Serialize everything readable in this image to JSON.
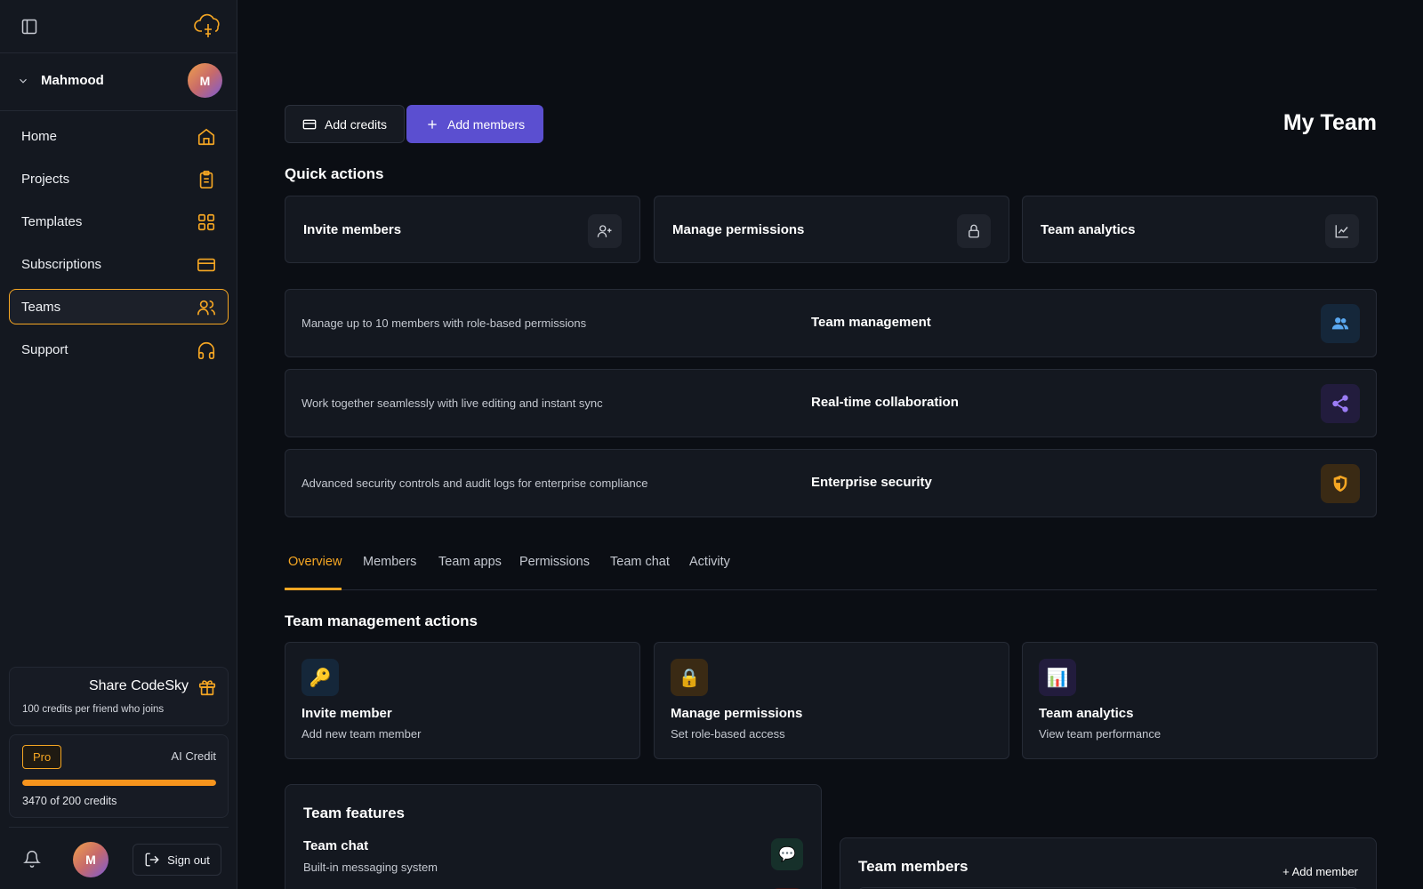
{
  "sidebar": {
    "user": {
      "name": "Mahmood",
      "initial": "M"
    },
    "nav": [
      {
        "label": "Home",
        "icon": "home-icon"
      },
      {
        "label": "Projects",
        "icon": "clipboard-icon"
      },
      {
        "label": "Templates",
        "icon": "grid-icon"
      },
      {
        "label": "Subscriptions",
        "icon": "credit-card-icon"
      },
      {
        "label": "Teams",
        "icon": "users-icon",
        "active": true
      },
      {
        "label": "Support",
        "icon": "headphones-icon"
      }
    ],
    "share": {
      "title": "Share CodeSky",
      "subtitle": "100 credits per friend who joins"
    },
    "credits": {
      "plan": "Pro",
      "label": "AI Credit",
      "text": "3470 of 200 credits",
      "progress_fraction": 1.0
    },
    "footer": {
      "avatar_initial": "M",
      "signout_label": "Sign out"
    }
  },
  "header": {
    "add_credits_label": "Add credits",
    "add_members_label": "Add members",
    "title": "My Team"
  },
  "quick_actions": {
    "title": "Quick actions",
    "items": [
      {
        "label": "Invite members",
        "icon": "user-plus-icon"
      },
      {
        "label": "Manage permissions",
        "icon": "lock-icon"
      },
      {
        "label": "Team analytics",
        "icon": "line-chart-icon"
      }
    ]
  },
  "features": [
    {
      "description": "Manage up to 10 members with role-based permissions",
      "title": "Team management",
      "icon": "users-icon",
      "icon_color": "#5aa8f0",
      "icon_bg": "#15273a"
    },
    {
      "description": "Work together seamlessly with live editing and instant sync",
      "title": "Real-time collaboration",
      "icon": "share-icon",
      "icon_color": "#9b7cf5",
      "icon_bg": "#221c3d"
    },
    {
      "description": "Advanced security controls and audit logs for enterprise compliance",
      "title": "Enterprise security",
      "icon": "shield-icon",
      "icon_color": "#f5a623",
      "icon_bg": "#3a2a14"
    }
  ],
  "tabs": [
    {
      "label": "Overview",
      "active": true
    },
    {
      "label": "Members"
    },
    {
      "label": "Team apps"
    },
    {
      "label": "Permissions"
    },
    {
      "label": "Team chat"
    },
    {
      "label": "Activity"
    }
  ],
  "management": {
    "title": "Team management actions",
    "items": [
      {
        "icon": "🔑",
        "icon_name": "key-icon",
        "icon_bg": "#15273a",
        "title": "Invite member",
        "subtitle": "Add new team member"
      },
      {
        "icon": "🔒",
        "icon_name": "lock-icon",
        "icon_bg": "#3a2a14",
        "title": "Manage permissions",
        "subtitle": "Set role-based access"
      },
      {
        "icon": "📊",
        "icon_name": "bar-chart-icon",
        "icon_bg": "#221c3d",
        "title": "Team analytics",
        "subtitle": "View team performance"
      }
    ]
  },
  "team_features": {
    "title": "Team features",
    "item": {
      "title": "Team chat",
      "subtitle": "Built-in messaging system",
      "icon": "💬",
      "icon_name": "chat-icon"
    }
  },
  "team_members": {
    "title": "Team members",
    "add_label": "+ Add member"
  },
  "colors": {
    "accent": "#f5a623",
    "primary": "#5b4fd0",
    "background": "#0b0e14",
    "sidebar": "#141820"
  }
}
